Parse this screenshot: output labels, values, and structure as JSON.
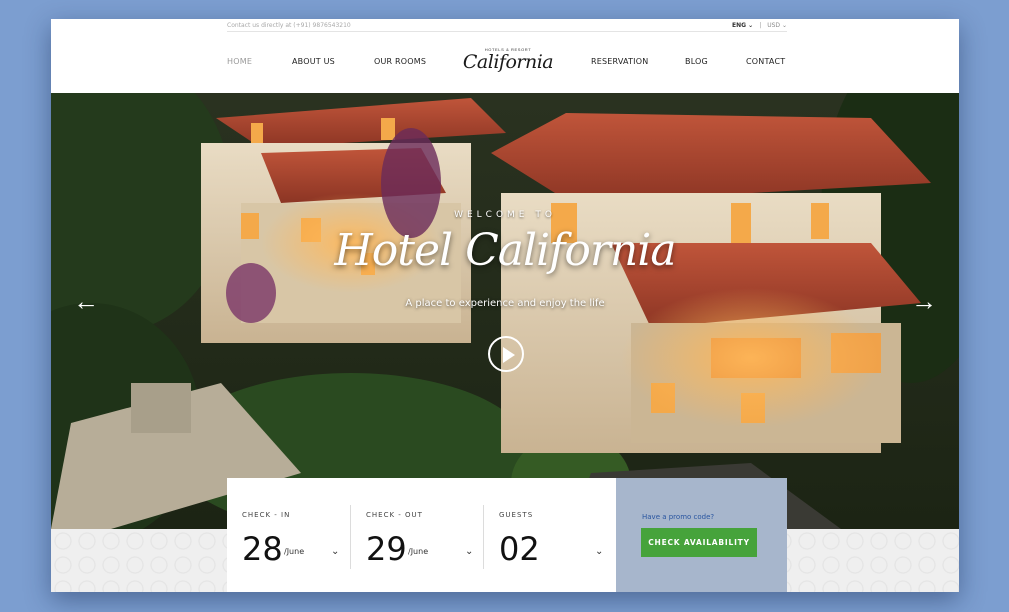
{
  "topbar": {
    "contact": "Contact us directly at (+91) 9876543210",
    "language": "ENG",
    "currency": "USD"
  },
  "nav": {
    "items": [
      {
        "label": "HOME"
      },
      {
        "label": "ABOUT US"
      },
      {
        "label": "OUR ROOMS"
      },
      {
        "label": "RESERVATION"
      },
      {
        "label": "BLOG"
      },
      {
        "label": "CONTACT"
      }
    ]
  },
  "logo": {
    "tagline": "HOTELS & RESORT",
    "name": "California"
  },
  "hero": {
    "welcome": "WELCOME TO",
    "title": "Hotel California",
    "subtitle": "A place to experience and  enjoy the life",
    "prev_icon": "arrow-left-icon",
    "next_icon": "arrow-right-icon",
    "play_icon": "play-icon"
  },
  "booking": {
    "checkin": {
      "label": "CHECK - IN",
      "day": "28",
      "month": "/June"
    },
    "checkout": {
      "label": "CHECK - OUT",
      "day": "29",
      "month": "/June"
    },
    "guests": {
      "label": "GUESTS",
      "count": "02"
    },
    "promo": "Have a promo code?",
    "button": "CHECK AVAILABILITY"
  },
  "colors": {
    "background": "#7c9ed0",
    "button": "#46a33b",
    "promo_panel": "#a7b6cc",
    "promo_text": "#2a56a0"
  }
}
